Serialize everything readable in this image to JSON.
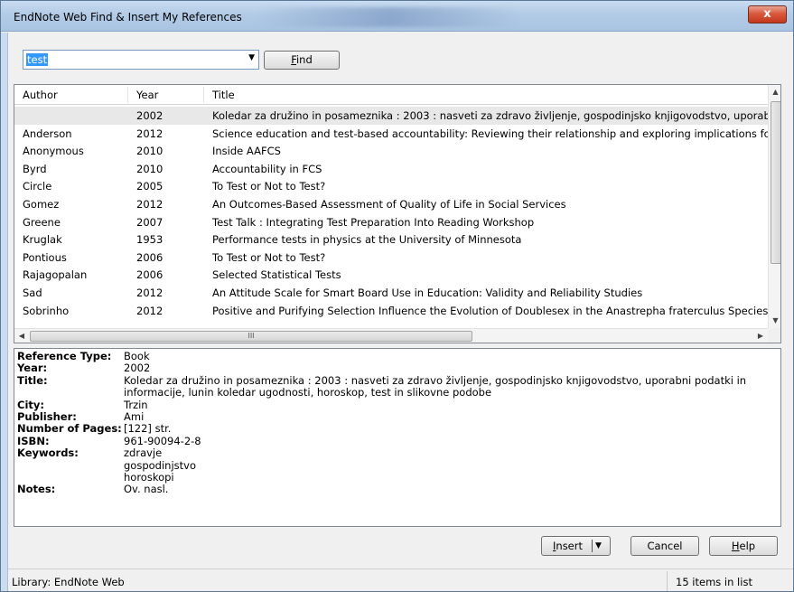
{
  "window": {
    "title": "EndNote Web Find & Insert My References",
    "close_glyph": "x"
  },
  "search": {
    "value": "test",
    "find_label_u": "F",
    "find_label_rest": "ind"
  },
  "list": {
    "columns": [
      "Author",
      "Year",
      "Title"
    ],
    "rows": [
      {
        "author": "",
        "year": "2002",
        "title": "Koledar za družino in posameznika : 2003 : nasveti za zdravo življenje, gospodinjsko knjigovodstvo, uporabni po"
      },
      {
        "author": "Anderson",
        "year": "2012",
        "title": "Science education and test-based accountability: Reviewing their relationship and exploring implications for futur"
      },
      {
        "author": "Anonymous",
        "year": "2010",
        "title": "Inside AAFCS"
      },
      {
        "author": "Byrd",
        "year": "2010",
        "title": "Accountability in FCS"
      },
      {
        "author": "Circle",
        "year": "2005",
        "title": "To Test or Not to Test?"
      },
      {
        "author": "Gomez",
        "year": "2012",
        "title": "An Outcomes-Based Assessment of Quality of Life in Social Services"
      },
      {
        "author": "Greene",
        "year": "2007",
        "title": "Test Talk : Integrating Test Preparation Into Reading Workshop"
      },
      {
        "author": "Kruglak",
        "year": "1953",
        "title": "Performance tests in physics at the University of Minnesota"
      },
      {
        "author": "Pontious",
        "year": "2006",
        "title": "To Test or Not to Test?"
      },
      {
        "author": "Rajagopalan",
        "year": "2006",
        "title": "Selected Statistical Tests"
      },
      {
        "author": "Sad",
        "year": "2012",
        "title": "An Attitude Scale for Smart Board Use in Education: Validity and Reliability Studies"
      },
      {
        "author": "Sobrinho",
        "year": "2012",
        "title": "Positive and Purifying Selection Influence the Evolution of Doublesex in the Anastrepha fraterculus Species Grou"
      }
    ],
    "hscroll_grip": "III"
  },
  "details": {
    "fields": [
      {
        "label": "Reference Type:",
        "lines": [
          "Book"
        ]
      },
      {
        "label": "Year:",
        "lines": [
          "2002"
        ]
      },
      {
        "label": "Title:",
        "lines": [
          "Koledar za družino in posameznika : 2003 : nasveti za zdravo življenje, gospodinjsko knjigovodstvo, uporabni podatki in informacije, lunin koledar ugodnosti, horoskop, test in slikovne podobe"
        ]
      },
      {
        "label": "City:",
        "lines": [
          "Trzin"
        ]
      },
      {
        "label": "Publisher:",
        "lines": [
          "Ami"
        ]
      },
      {
        "label": "Number of Pages:",
        "lines": [
          "[122] str."
        ]
      },
      {
        "label": "ISBN:",
        "lines": [
          "961-90094-2-8"
        ]
      },
      {
        "label": "Keywords:",
        "lines": [
          "zdravje",
          "gospodinjstvo",
          "horoskopi"
        ]
      },
      {
        "label": "Notes:",
        "lines": [
          "Ov. nasl."
        ]
      }
    ]
  },
  "buttons": {
    "insert_u": "I",
    "insert_rest": "nsert",
    "cancel": "Cancel",
    "help_u": "H",
    "help_rest": "elp"
  },
  "status": {
    "library": "Library: EndNote Web",
    "count": "15 items in list"
  }
}
